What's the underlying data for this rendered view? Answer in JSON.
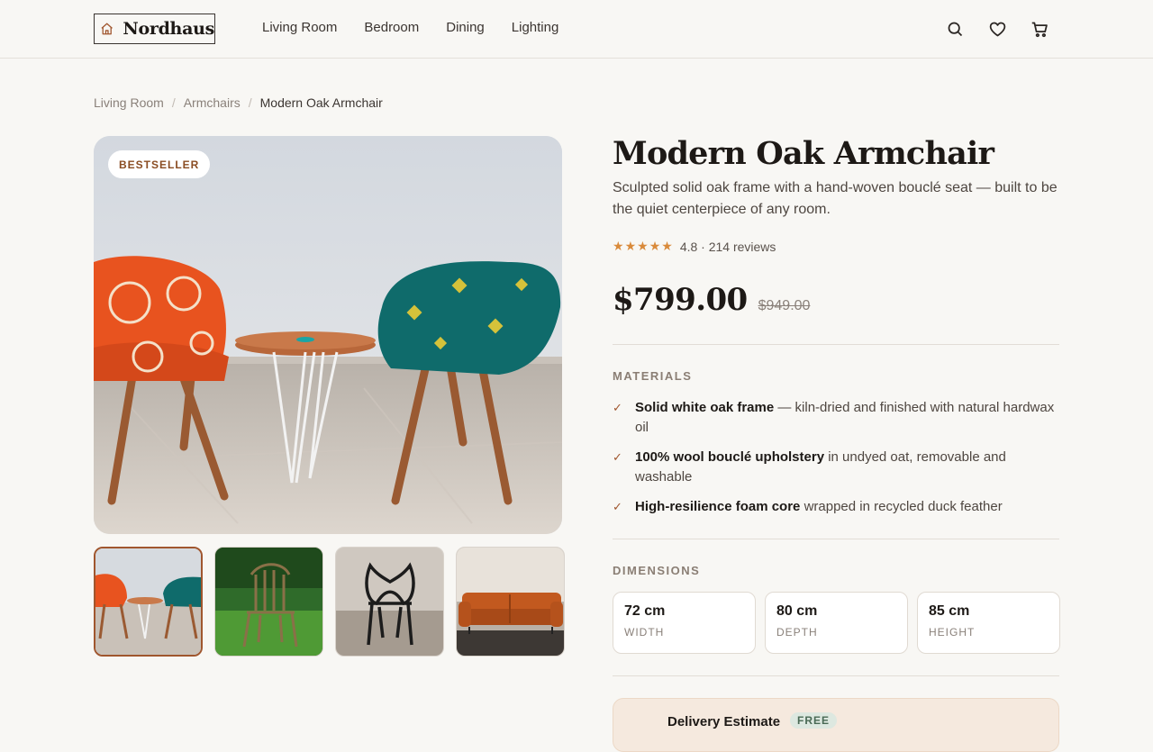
{
  "brand": {
    "name": "Nordhaus",
    "logo_icon": "house-icon"
  },
  "nav": [
    "Living Room",
    "Bedroom",
    "Dining",
    "Lighting"
  ],
  "header_icons": [
    "search-icon",
    "heart-icon",
    "cart-icon"
  ],
  "breadcrumb": [
    "Living Room",
    "Armchairs",
    "Modern Oak Armchair"
  ],
  "gallery": {
    "badge": "BESTSELLER",
    "thumb_count": 4,
    "active_thumb": 1
  },
  "product": {
    "title": "Modern Oak Armchair",
    "description": "Sculpted solid oak frame with a hand-woven bouclé seat — built to be the quiet centerpiece of any room.",
    "rating_text": "4.8 · 214 reviews",
    "stars": 5,
    "price": "$799.00",
    "old_price": "$949.00"
  },
  "materials": {
    "label": "MATERIALS",
    "items": [
      {
        "bold": "Solid white oak frame",
        "rest": " — kiln-dried and finished with natural hardwax oil"
      },
      {
        "bold": "100% wool bouclé upholstery",
        "rest": " in undyed oat, removable and washable"
      },
      {
        "bold": "High-resilience foam core",
        "rest": " wrapped in recycled duck feather"
      }
    ]
  },
  "dimensions": {
    "label": "DIMENSIONS",
    "items": [
      {
        "value": "72 cm",
        "label": "WIDTH"
      },
      {
        "value": "80 cm",
        "label": "DEPTH"
      },
      {
        "value": "85 cm",
        "label": "HEIGHT"
      }
    ]
  },
  "delivery": {
    "title": "Delivery Estimate",
    "tag": "FREE"
  },
  "colors": {
    "accent": "#a0562e",
    "star": "#d98a3b",
    "background": "#f8f7f4"
  }
}
